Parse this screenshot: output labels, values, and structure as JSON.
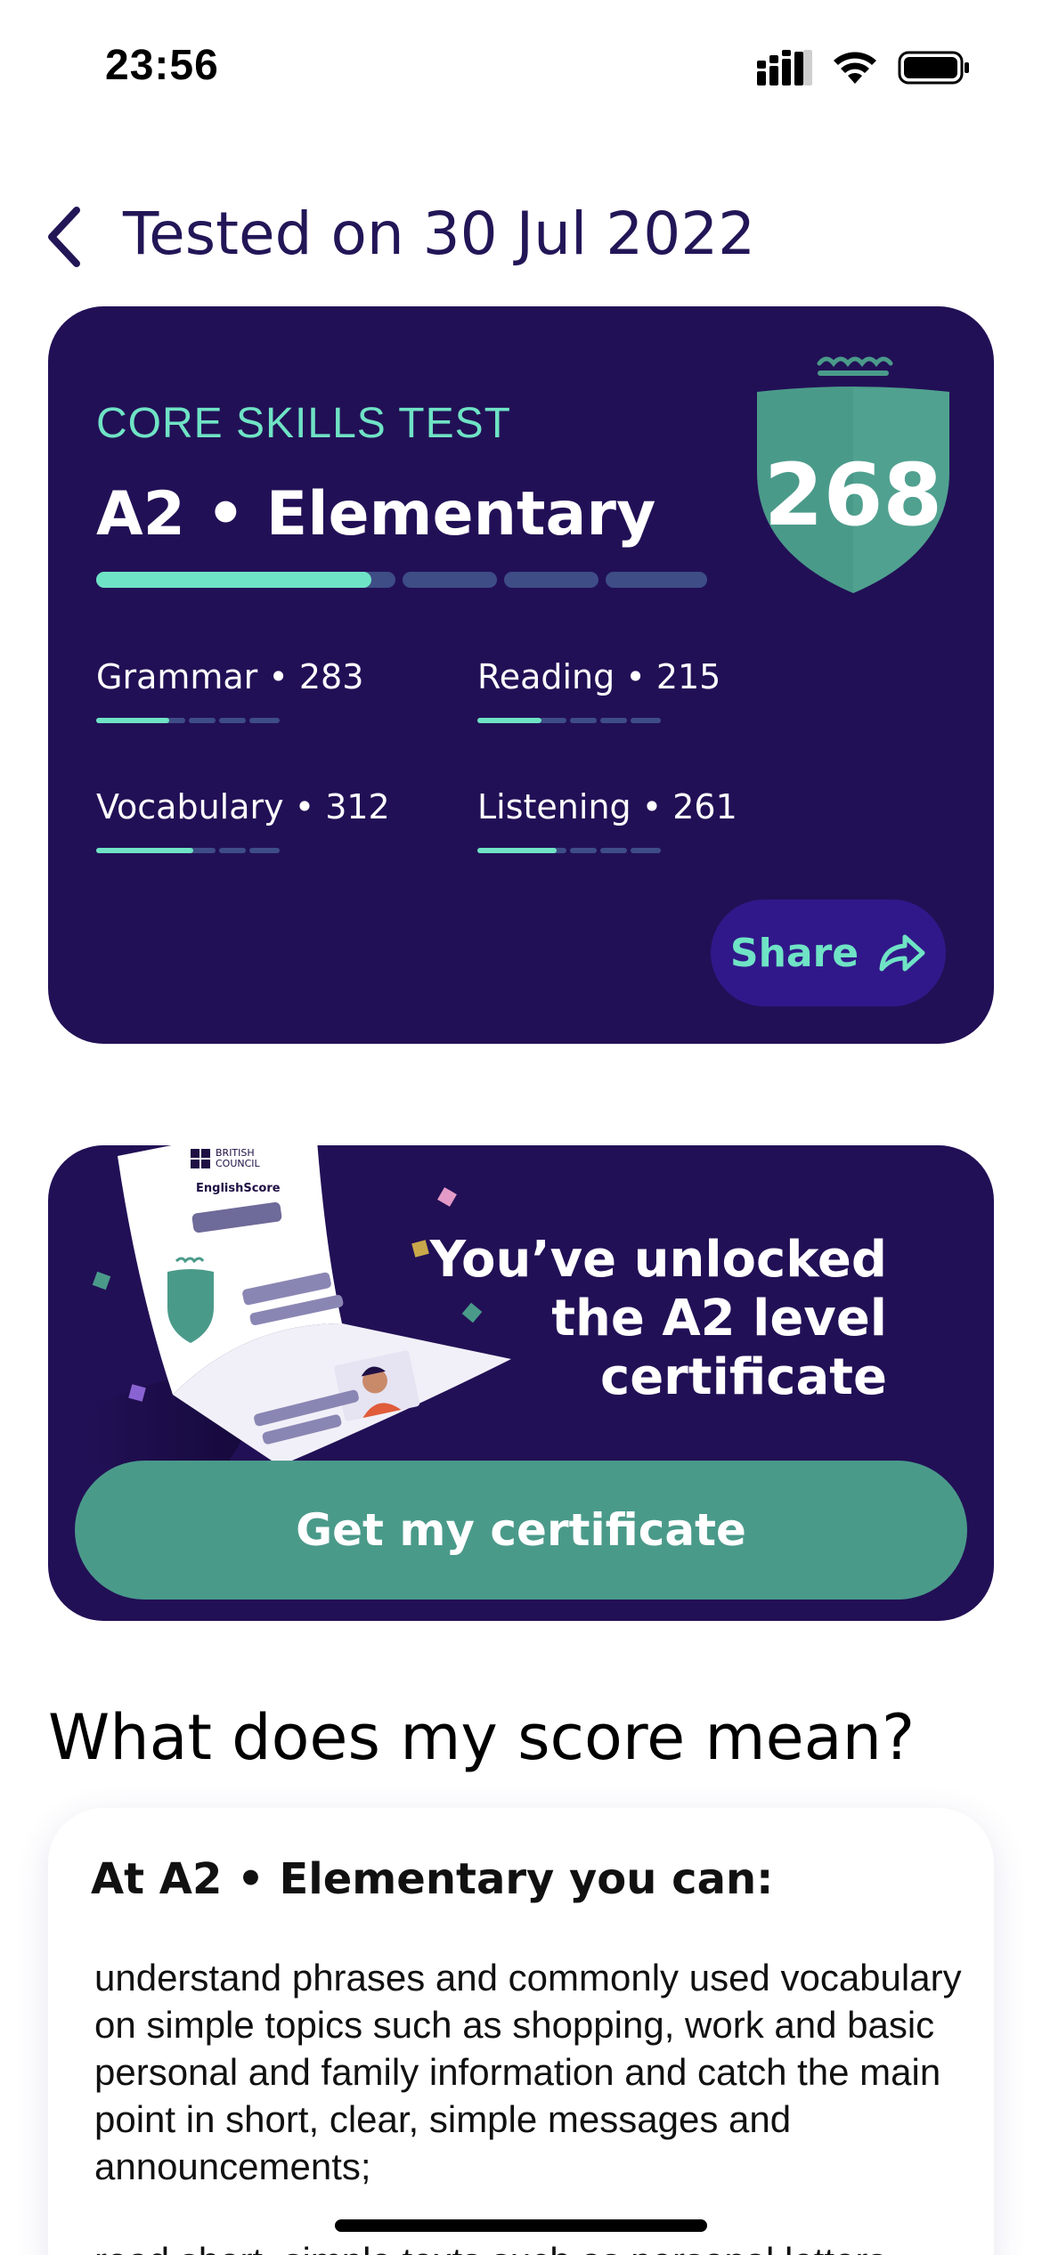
{
  "status_bar": {
    "time": "23:56",
    "icons": [
      "signal-icon",
      "wifi-icon",
      "battery-icon"
    ]
  },
  "header": {
    "back_icon": "chevron-left-icon",
    "title": "Tested on 30 Jul 2022"
  },
  "score_card": {
    "test_name": "CORE SKILLS TEST",
    "level": "A2 • Elementary",
    "overall_score": "268",
    "overall_progress_fraction": 0.45,
    "skills": [
      {
        "label": "Grammar • 283",
        "progress_fraction": 0.4
      },
      {
        "label": "Reading • 215",
        "progress_fraction": 0.35
      },
      {
        "label": "Vocabulary • 312",
        "progress_fraction": 0.53
      },
      {
        "label": "Listening • 261",
        "progress_fraction": 0.43
      }
    ],
    "share_label": "Share",
    "share_icon": "share-arrow-icon"
  },
  "certificate": {
    "message_lines": [
      "You’ve unlocked",
      "the A2 level",
      "certificate"
    ],
    "button_label": "Get my certificate",
    "illustration_text": {
      "org_line1": "BRITISH",
      "org_line2": "COUNCIL",
      "product": "EnglishScore"
    }
  },
  "meaning": {
    "heading": "What does my score mean?",
    "card_title": "At A2 • Elementary you can:",
    "paragraphs": [
      "understand phrases and commonly used vocabulary on simple topics such as shopping, work and basic personal and family information and catch the main point in short, clear, simple messages and announcements;",
      "read short, simple texts such as personal letters"
    ]
  },
  "colors": {
    "card_bg": "#221056",
    "accent_mint": "#6fe3c5",
    "shield_green": "#4a9a8a",
    "title_navy": "#231657",
    "share_bg": "#31188a",
    "bar_track": "#3e4d86"
  }
}
